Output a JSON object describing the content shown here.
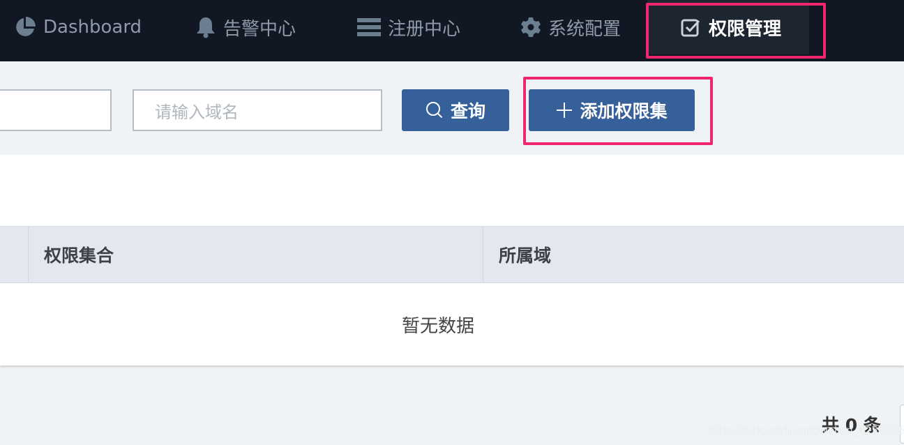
{
  "nav": {
    "items": [
      {
        "label": "Dashboard",
        "icon": "pie-chart-icon"
      },
      {
        "label": "告警中心",
        "icon": "bell-icon"
      },
      {
        "label": "注册中心",
        "icon": "server-icon"
      },
      {
        "label": "系统配置",
        "icon": "gear-icon"
      },
      {
        "label": "权限管理",
        "icon": "checkbox-icon",
        "active": true
      }
    ]
  },
  "toolbar": {
    "first_input_value": "",
    "domain_placeholder": "请输入域名",
    "query_label": "查询",
    "add_label": "添加权限集"
  },
  "table": {
    "columns": [
      "",
      "权限集合",
      "所属域"
    ],
    "empty_text": "暂无数据"
  },
  "pagination": {
    "total_label": "共 0 条"
  },
  "watermark": "https://blog.csdn.net/weixin_42528266",
  "colors": {
    "nav_bg": "#111823",
    "primary": "#36609a",
    "highlight": "#f0266e"
  }
}
